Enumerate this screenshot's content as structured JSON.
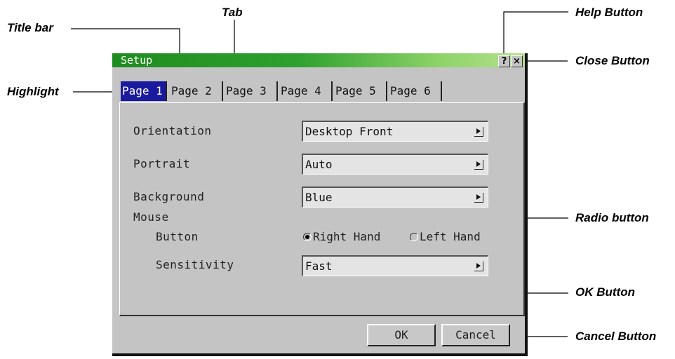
{
  "callouts": {
    "title_bar": "Title bar",
    "tab": "Tab",
    "help_button": "Help Button",
    "close_button": "Close Button",
    "highlight": "Highlight",
    "radio_button": "Radio button",
    "ok_button": "OK Button",
    "cancel_button": "Cancel Button"
  },
  "dialog": {
    "title": "Setup",
    "help_label": "?",
    "close_label": "×",
    "tabs": [
      "Page 1",
      "Page 2",
      "Page 3",
      "Page 4",
      "Page 5",
      "Page 6"
    ],
    "selected_tab": "Page 1",
    "orientation": {
      "label": "Orientation",
      "value": "Desktop Front"
    },
    "portrait": {
      "label": "Portrait",
      "value": "Auto"
    },
    "background": {
      "label": "Background",
      "value": "Blue"
    },
    "mouse": {
      "label": "Mouse",
      "button_label": "Button",
      "right_hand": "Right Hand",
      "left_hand": "Left Hand",
      "selected": "Right Hand",
      "sensitivity_label": "Sensitivity",
      "sensitivity_value": "Fast"
    },
    "ok_label": "OK",
    "cancel_label": "Cancel"
  },
  "colors": {
    "title_bar": "#2ea12e",
    "highlight": "#1a1a9e",
    "dialog_bg": "#c4c4c4"
  }
}
